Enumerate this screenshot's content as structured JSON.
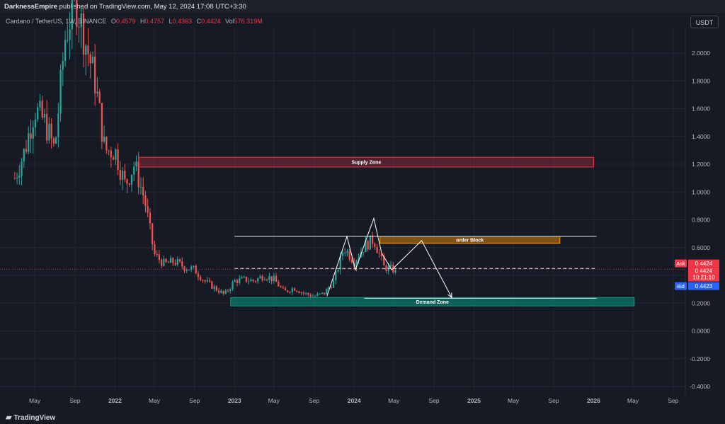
{
  "header": {
    "publisher_name": "DarknessEmpire",
    "publisher_text": " published on TradingView.com, May 12, 2024 17:08 UTC+3:30"
  },
  "legend": {
    "symbol": "Cardano / TetherUS, 1W, BINANCE",
    "open_label": "O",
    "open": "0.4579",
    "high_label": "H",
    "high": "0.4757",
    "low_label": "L",
    "low": "0.4363",
    "close_label": "C",
    "close": "0.4424",
    "vol_label": "Vol",
    "vol": "576.319M"
  },
  "currency_button": "USDT",
  "footer": {
    "brand": "TradingView"
  },
  "colors": {
    "up": "#26a69a",
    "down": "#ef5350",
    "supply": "#f23645",
    "order_block": "#ff9800",
    "demand": "#089981",
    "bid": "#2962ff"
  },
  "chart_data": {
    "type": "candlestick",
    "ylim": [
      -0.4,
      2.3
    ],
    "y_ticks": [
      "2.0000",
      "1.8000",
      "1.6000",
      "1.4000",
      "1.2000",
      "1.0000",
      "0.8000",
      "0.6000",
      "0.4000",
      "0.2000",
      "0.0000",
      "-0.2000",
      "-0.4000"
    ],
    "y_tick_values": [
      2.0,
      1.8,
      1.6,
      1.4,
      1.2,
      1.0,
      0.8,
      0.6,
      0.4,
      0.2,
      0.0,
      -0.2,
      -0.4
    ],
    "x_ticks": [
      "May",
      "Sep",
      "2022",
      "May",
      "Sep",
      "2023",
      "May",
      "Sep",
      "2024",
      "May",
      "Sep",
      "2025",
      "May",
      "Sep",
      "2026",
      "May",
      "Sep"
    ],
    "x_tick_dates": [
      "2021-05-01",
      "2021-09-01",
      "2022-01-01",
      "2022-05-01",
      "2022-09-01",
      "2023-01-01",
      "2023-05-01",
      "2023-09-01",
      "2024-01-01",
      "2024-05-01",
      "2024-09-01",
      "2025-01-01",
      "2025-05-01",
      "2025-09-01",
      "2026-01-01",
      "2026-05-01",
      "2026-09-01"
    ],
    "price_path": [
      [
        "2021-03-01",
        1.1
      ],
      [
        "2021-04-01",
        1.3
      ],
      [
        "2021-05-01",
        1.6
      ],
      [
        "2021-06-01",
        1.5
      ],
      [
        "2021-07-01",
        1.3
      ],
      [
        "2021-08-01",
        2.1
      ],
      [
        "2021-09-01",
        2.4
      ],
      [
        "2021-10-01",
        2.1
      ],
      [
        "2021-11-01",
        1.8
      ],
      [
        "2021-12-01",
        1.3
      ],
      [
        "2022-01-01",
        1.3
      ],
      [
        "2022-02-01",
        1.05
      ],
      [
        "2022-03-01",
        1.2
      ],
      [
        "2022-04-01",
        0.95
      ],
      [
        "2022-05-01",
        0.55
      ],
      [
        "2022-06-01",
        0.48
      ],
      [
        "2022-07-01",
        0.5
      ],
      [
        "2022-08-01",
        0.46
      ],
      [
        "2022-09-01",
        0.44
      ],
      [
        "2022-10-01",
        0.36
      ],
      [
        "2022-11-01",
        0.31
      ],
      [
        "2022-12-01",
        0.26
      ],
      [
        "2023-01-01",
        0.36
      ],
      [
        "2023-02-01",
        0.37
      ],
      [
        "2023-03-01",
        0.36
      ],
      [
        "2023-04-01",
        0.4
      ],
      [
        "2023-05-01",
        0.37
      ],
      [
        "2023-06-01",
        0.28
      ],
      [
        "2023-07-01",
        0.31
      ],
      [
        "2023-08-01",
        0.27
      ],
      [
        "2023-09-01",
        0.25
      ],
      [
        "2023-10-01",
        0.27
      ],
      [
        "2023-11-01",
        0.36
      ],
      [
        "2023-12-01",
        0.6
      ],
      [
        "2024-01-01",
        0.5
      ],
      [
        "2024-02-01",
        0.61
      ],
      [
        "2024-03-01",
        0.66
      ],
      [
        "2024-04-01",
        0.46
      ],
      [
        "2024-05-01",
        0.44
      ]
    ],
    "last_price": 0.4424,
    "zones": [
      {
        "name": "Supply Zone",
        "label": "Supply Zone",
        "from": "2022-03-15",
        "to": "2026-01-01",
        "y1": 1.18,
        "y2": 1.25
      },
      {
        "name": "order Block",
        "label": "order Block",
        "from": "2024-03-20",
        "to": "2025-09-20",
        "y1": 0.63,
        "y2": 0.68
      },
      {
        "name": "Demand Zone",
        "label": "Demand Zone",
        "from": "2022-12-20",
        "to": "2026-05-05",
        "y1": 0.18,
        "y2": 0.24
      }
    ],
    "hlines": [
      {
        "y": 0.68,
        "from": "2023-01-01",
        "to": "2026-01-10",
        "style": "solid"
      },
      {
        "y": 0.45,
        "from": "2023-01-01",
        "to": "2026-01-10",
        "style": "dashed"
      },
      {
        "y": 0.235,
        "from": "2024-02-01",
        "to": "2026-01-10",
        "style": "solid"
      }
    ],
    "pattern": [
      [
        "2023-10-10",
        0.25
      ],
      [
        "2023-12-10",
        0.68
      ],
      [
        "2024-01-05",
        0.44
      ],
      [
        "2024-02-10",
        0.68
      ],
      [
        "2024-03-01",
        0.81
      ],
      [
        "2024-03-25",
        0.56
      ],
      [
        "2024-04-25",
        0.44
      ],
      [
        "2024-07-25",
        0.65
      ],
      [
        "2024-10-25",
        0.24
      ]
    ],
    "price_labels": [
      {
        "label": "Ask",
        "value": "0.4424",
        "y": 0.4424,
        "color": "#f23645"
      },
      {
        "label": "",
        "value": "0.4424",
        "y": 0.4424,
        "color": "#f23645"
      },
      {
        "label": "",
        "value": "10:21:10",
        "y": 0.4424,
        "color": "#f23645"
      },
      {
        "label": "Bid",
        "value": "0.4423",
        "y": 0.4423,
        "color": "#2962ff"
      }
    ]
  }
}
